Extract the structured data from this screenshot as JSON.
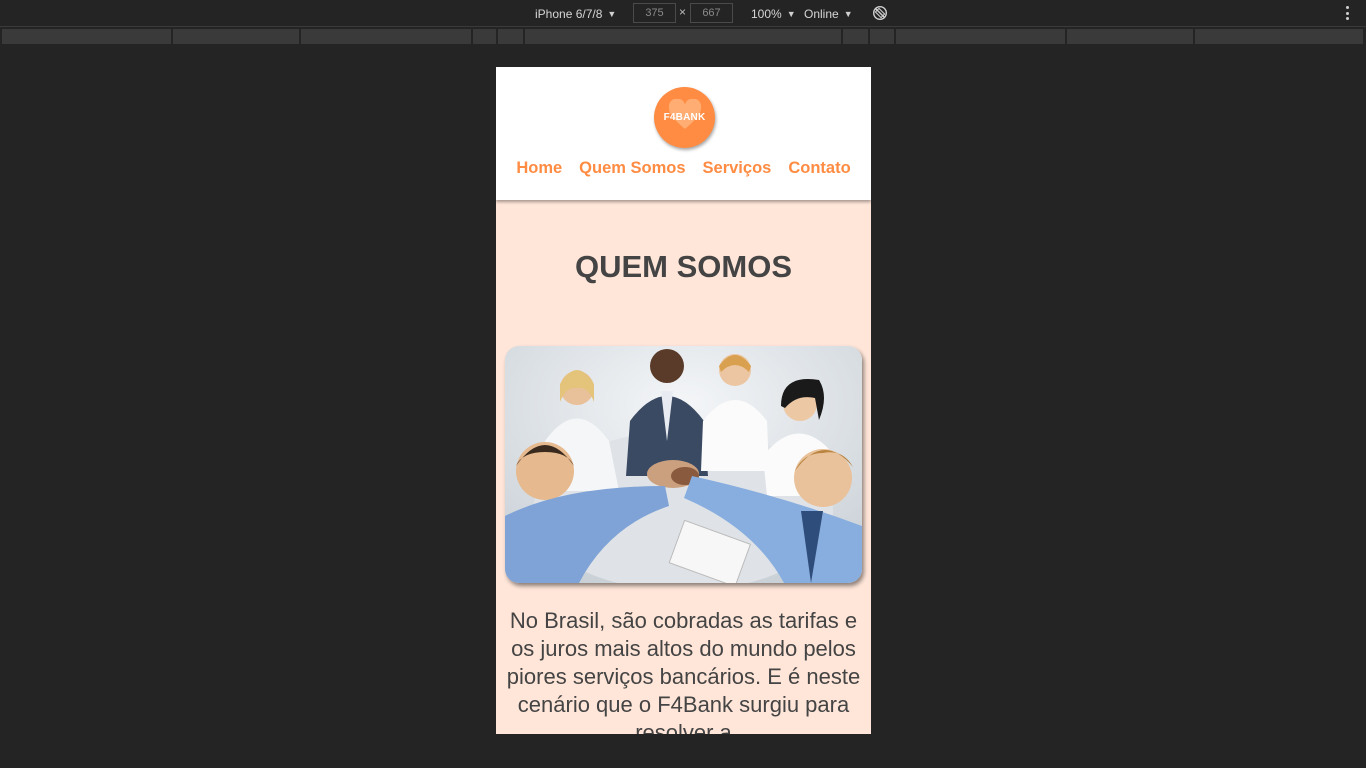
{
  "devtools": {
    "device_name": "iPhone 6/7/8",
    "width_value": "375",
    "height_value": "667",
    "dimension_separator": "×",
    "zoom": "100%",
    "throttling": "Online",
    "icons": [
      "chevron-down-icon",
      "rotate-icon",
      "kebab-menu-icon"
    ]
  },
  "site": {
    "logo_text": "F4BANK",
    "nav": [
      "Home",
      "Quem Somos",
      "Serviços",
      "Contato"
    ],
    "section_title": "QUEM SOMOS",
    "about_text": "No Brasil, são cobradas as tarifas e os juros mais altos do mundo pelos piores serviços bancários. E é neste cenário que o F4Bank surgiu para resolver a"
  },
  "colors": {
    "accent": "#ff8c42",
    "section_bg": "#ffe6d9",
    "text": "#444444",
    "devtools_bg": "#242424"
  }
}
